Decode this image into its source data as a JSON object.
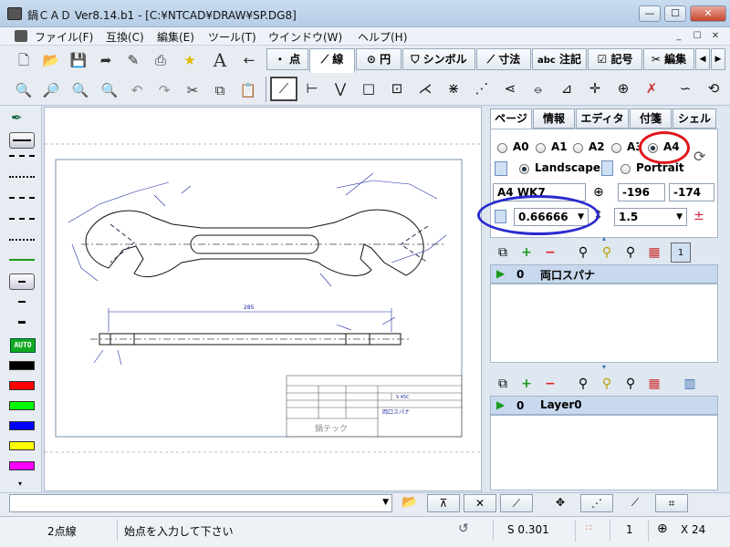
{
  "title": "鍋ＣＡＤ Ver8.14.b1 - [C:¥NTCAD¥DRAW¥SP.DG8]",
  "window_controls": {
    "minimize": "—",
    "maximize": "☐",
    "close": "✕"
  },
  "menu": [
    "ファイル(F)",
    "互換(C)",
    "編集(E)",
    "ツール(T)",
    "ウインドウ(W)",
    "ヘルプ(H)"
  ],
  "mdi_controls": [
    "_",
    "☐",
    "✕"
  ],
  "file_toolbar_icons": [
    "new-icon",
    "open-icon",
    "save-icon",
    "export-icon",
    "import-icon",
    "print-icon",
    "star-icon",
    "text-icon",
    "arrow-icon"
  ],
  "file_toolbar_glyphs": [
    "🗋",
    "📂",
    "💾",
    "➦",
    "✎",
    "⎙",
    "★",
    "A",
    "←"
  ],
  "zoom_toolbar_glyphs": [
    "🔍",
    "🔎",
    "🔍",
    "🔍",
    "↶",
    "↷",
    "✂",
    "⧉",
    "📋"
  ],
  "zoom_toolbar_icons": [
    "zoom-window-icon",
    "zoom-all-icon",
    "zoom-in-icon",
    "zoom-out-icon",
    "undo-icon",
    "redo-icon",
    "cut-icon",
    "copy-icon",
    "paste-icon"
  ],
  "mode_tabs": [
    {
      "glyph": "・",
      "label": "点"
    },
    {
      "glyph": "⟋",
      "label": "線"
    },
    {
      "glyph": "⊙",
      "label": "円"
    },
    {
      "glyph": "⛉",
      "label": "シンボル"
    },
    {
      "glyph": "⟋",
      "label": "寸法"
    },
    {
      "glyph": "abc",
      "label": "注記"
    },
    {
      "glyph": "☑",
      "label": "記号"
    },
    {
      "glyph": "✂",
      "label": "編集"
    }
  ],
  "tab_nav": [
    "◀",
    "▶"
  ],
  "draw_tools": [
    "⟋",
    "⊢",
    "⋁",
    "□",
    "⊡",
    "⋌",
    "⋇",
    "⋰",
    "⋖",
    "⦵",
    "⊿",
    "✛",
    "⊕",
    "✗",
    "∽",
    "⟲"
  ],
  "line_styles": [
    "solid",
    "dashed",
    "dotted",
    "dashdot",
    "dash2",
    "dot2"
  ],
  "auto_label": "AUTO",
  "layer_colors": [
    "#000000",
    "#ff0000",
    "#00ff00",
    "#0000ff",
    "#ffff00",
    "#ff00ff"
  ],
  "panel_tabs": [
    "ページ",
    "情報",
    "エディタ",
    "付箋",
    "シェル"
  ],
  "paper_sizes": [
    "A0",
    "A1",
    "A2",
    "A3",
    "A4"
  ],
  "selected_paper": "A4",
  "orientation": {
    "landscape": "Landscape",
    "portrait": "Portrait",
    "selected": "Landscape"
  },
  "paper_preset": "A4 WK7",
  "origin_x": "-196",
  "origin_y": "-174",
  "scale": "0.66666",
  "line_scale": "1.5",
  "parts_layers": [
    {
      "visible_icon": "▶",
      "index": "0",
      "name": "両口スパナ"
    }
  ],
  "layers": [
    {
      "visible_icon": "▶",
      "index": "0",
      "name": "Layer0"
    }
  ],
  "drawing": {
    "overall_dimension": "285",
    "titleblock_company": "鍋テック",
    "titleblock_part": "両口スパナ",
    "titleblock_material": "S 45C"
  },
  "snap_buttons": [
    "⊼",
    "✕",
    "⟋",
    "✥",
    "⋰",
    "⟋",
    "⌗"
  ],
  "status": {
    "mode": "2点線",
    "prompt": "始点を入力して下さい",
    "scale": "S 0.301",
    "layer": "1",
    "coord": "X 24"
  },
  "highlight_colors": {
    "red_circle": "#e0151a",
    "blue_circle": "#2a2ad0",
    "accent": "#3a6fb0"
  }
}
